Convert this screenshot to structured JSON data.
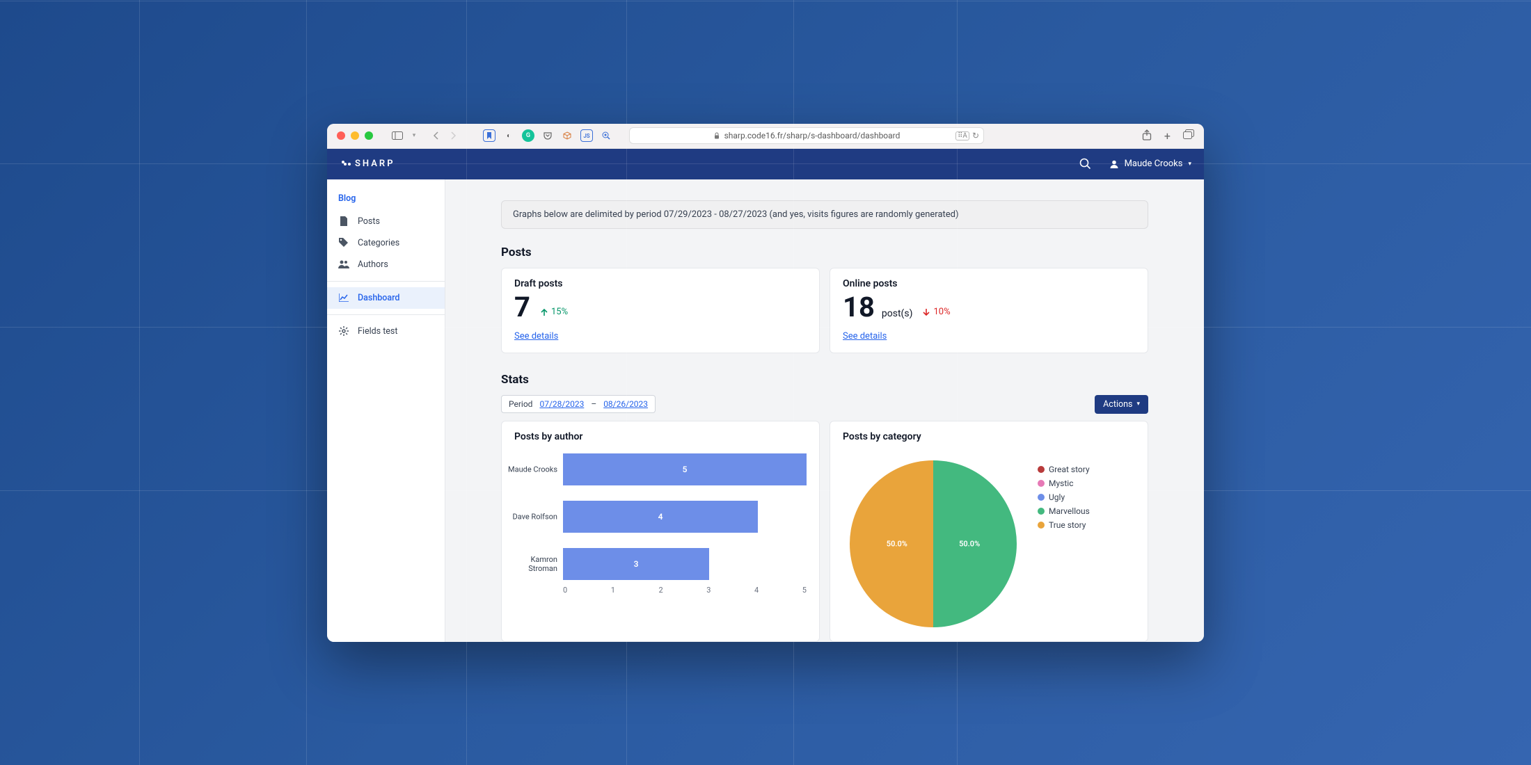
{
  "browser": {
    "url": "sharp.code16.fr/sharp/s-dashboard/dashboard"
  },
  "header": {
    "logo": "SHARP",
    "user_name": "Maude Crooks"
  },
  "sidebar": {
    "heading": "Blog",
    "items": [
      {
        "label": "Posts",
        "icon": "file-icon"
      },
      {
        "label": "Categories",
        "icon": "tag-icon"
      },
      {
        "label": "Authors",
        "icon": "users-icon"
      }
    ],
    "dashboard_label": "Dashboard",
    "fields_test_label": "Fields test"
  },
  "notice": "Graphs below are delimited by period 07/29/2023 - 08/27/2023 (and yes, visits figures are randomly generated)",
  "posts": {
    "title": "Posts",
    "draft": {
      "label": "Draft posts",
      "value": "7",
      "delta": "15%",
      "delta_dir": "up",
      "link": "See details"
    },
    "online": {
      "label": "Online posts",
      "value": "18",
      "unit": "post(s)",
      "delta": "10%",
      "delta_dir": "down",
      "link": "See details"
    }
  },
  "stats": {
    "title": "Stats",
    "period_label": "Period",
    "period_from": "07/28/2023",
    "period_sep": "–",
    "period_to": "08/26/2023",
    "actions": "Actions"
  },
  "chart_data": [
    {
      "type": "bar",
      "title": "Posts by author",
      "orientation": "horizontal",
      "categories": [
        "Maude Crooks",
        "Dave Rolfson",
        "Kamron Stroman"
      ],
      "values": [
        5,
        4,
        3
      ],
      "xlim": [
        0,
        5
      ],
      "xticks": [
        0,
        1,
        2,
        3,
        4,
        5
      ]
    },
    {
      "type": "pie",
      "title": "Posts by category",
      "series": [
        {
          "name": "Great story",
          "value": 0,
          "color": "#b83b3b"
        },
        {
          "name": "Mystic",
          "value": 0,
          "color": "#e679b6"
        },
        {
          "name": "Ugly",
          "value": 0,
          "color": "#6d8ee8"
        },
        {
          "name": "Marvellous",
          "value": 50,
          "color": "#43b97f"
        },
        {
          "name": "True story",
          "value": 50,
          "color": "#e9a43b"
        }
      ],
      "labels": [
        "50.0%",
        "50.0%"
      ]
    }
  ]
}
